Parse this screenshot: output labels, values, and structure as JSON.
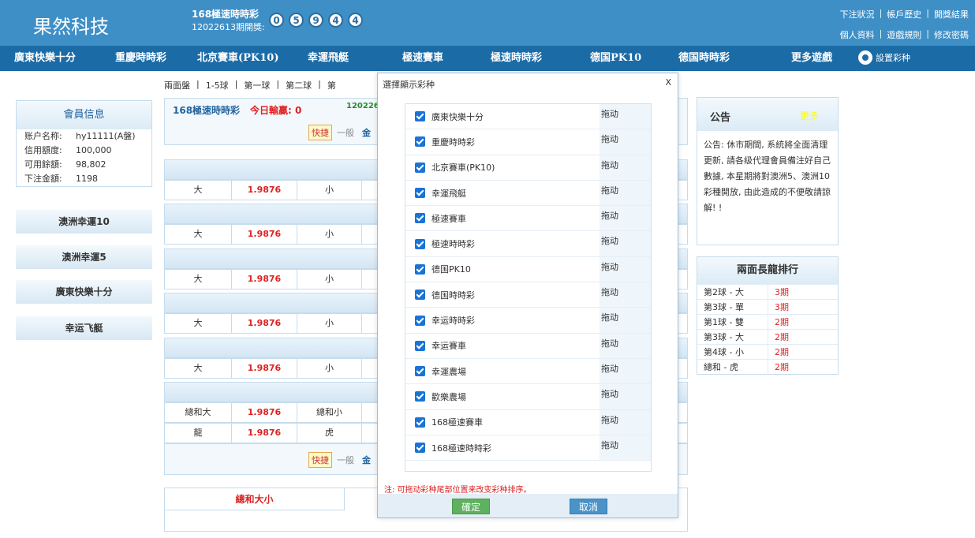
{
  "header": {
    "brand": "果然科技",
    "lottery_title": "168極速時時彩",
    "lottery_issue": "12022613期開獎:",
    "balls": [
      "0",
      "5",
      "9",
      "4",
      "4"
    ],
    "links_row1": [
      "下注狀況",
      "帳戶歷史",
      "開獎結果"
    ],
    "links_row2": [
      "個人資料",
      "遊戲規則",
      "修改密碼"
    ],
    "separator": "|"
  },
  "nav": {
    "items": [
      "廣東快樂十分",
      "重慶時時彩",
      "北京賽車(PK10)",
      "幸運飛艇",
      "極速賽車",
      "極速時時彩",
      "德国PK10",
      "德国時時彩",
      "更多遊戲"
    ],
    "settings_label": "設置彩种"
  },
  "subtabs": [
    "兩面盤",
    "|",
    "1-5球",
    "|",
    "第一球",
    "|",
    "第二球",
    "|",
    "第"
  ],
  "member": {
    "title": "會員信息",
    "rows": [
      {
        "k": "账户名称:",
        "v": "hy11111(A盤)"
      },
      {
        "k": "信用額度:",
        "v": "100,000"
      },
      {
        "k": "可用餘額:",
        "v": "98,802"
      },
      {
        "k": "下注金額:",
        "v": "1198"
      }
    ]
  },
  "left_buttons": [
    "澳洲幸運10",
    "澳洲幸運5",
    "廣東快樂十分",
    "幸运飞艇"
  ],
  "main": {
    "title": "168極速時時彩",
    "today_win": "今日輸贏: 0",
    "issue_partial": "1202261",
    "quick": "快捷",
    "normal": "一般",
    "gold": "金",
    "rows": [
      {
        "a": "大",
        "b": "1.9876",
        "c": "小"
      },
      {
        "a": "大",
        "b": "1.9876",
        "c": "小"
      },
      {
        "a": "大",
        "b": "1.9876",
        "c": "小"
      },
      {
        "a": "大",
        "b": "1.9876",
        "c": "小"
      },
      {
        "a": "大",
        "b": "1.9876",
        "c": "小"
      },
      {
        "a": "總和大",
        "b": "1.9876",
        "c": "總和小"
      },
      {
        "a": "龍",
        "b": "1.9876",
        "c": "虎"
      }
    ],
    "bottom_tab": "總和大小"
  },
  "notice": {
    "title": "公告",
    "more": "更多",
    "body": "公告: 休市期間, 系統將全面清理更新, 請各级代理會員備注好自己數據, 本星期將對澳洲5、澳洲10彩種開放, 由此造成的不便敬請諒解! !"
  },
  "dragon": {
    "title": "兩面長龍排行",
    "rows": [
      {
        "k": "第2球 - 大",
        "v": "3期"
      },
      {
        "k": "第3球 - 單",
        "v": "3期"
      },
      {
        "k": "第1球 - 雙",
        "v": "2期"
      },
      {
        "k": "第3球 - 大",
        "v": "2期"
      },
      {
        "k": "第4球 - 小",
        "v": "2期"
      },
      {
        "k": "總和 - 虎",
        "v": "2期"
      }
    ]
  },
  "modal": {
    "title": "選擇顯示彩种",
    "close": "X",
    "drag_label": "拖动",
    "items": [
      "廣東快樂十分",
      "重慶時時彩",
      "北京賽車(PK10)",
      "幸運飛艇",
      "極速賽車",
      "極速時時彩",
      "德国PK10",
      "德国時時彩",
      "幸运時時彩",
      "幸运賽車",
      "幸運農場",
      "歡樂農場",
      "168極速賽車",
      "168極速時時彩"
    ],
    "note": "注: 可拖动彩种尾部位置来改变彩种排序。",
    "ok": "確定",
    "cancel": "取消"
  },
  "colors": {
    "header_bg": "#3f8fc7",
    "nav_bg": "#1b6ba6",
    "accent_red": "#d22",
    "checkbox": "#1a73d6"
  }
}
